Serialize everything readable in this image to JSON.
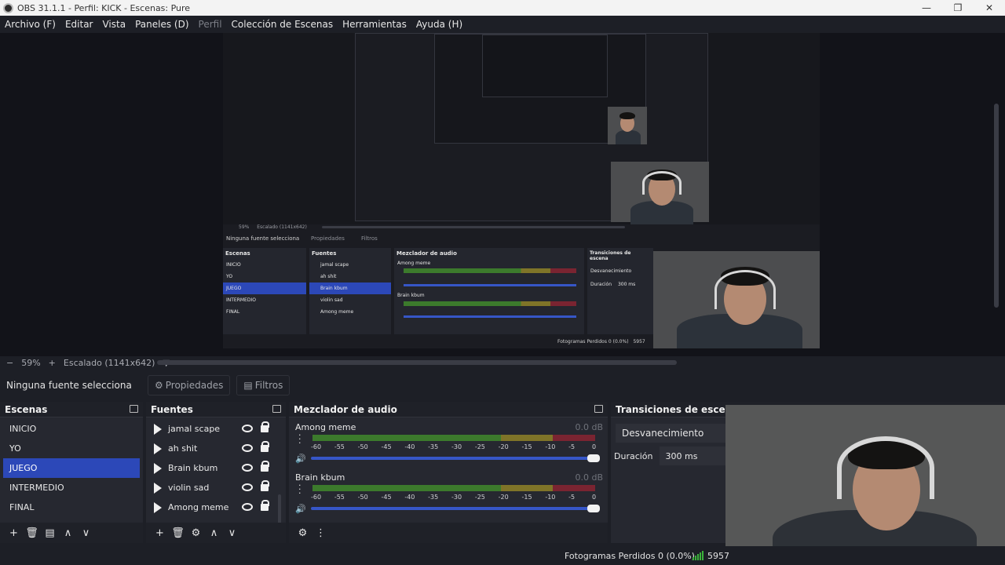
{
  "window": {
    "title": "OBS 31.1.1 - Perfil: KICK - Escenas: Pure",
    "minimize": "—",
    "restore": "❐",
    "close": "✕"
  },
  "menu": {
    "items": [
      "Archivo (F)",
      "Editar",
      "Vista",
      "Paneles (D)",
      "Perfil",
      "Colección de Escenas",
      "Herramientas",
      "Ayuda (H)"
    ]
  },
  "preview": {
    "zoom_minus": "−",
    "zoom_level": "59%",
    "zoom_plus": "+",
    "scale_label": "Escalado (1141x642)",
    "nested": {
      "no_source": "Ninguna fuente selecciona",
      "properties": "Propiedades",
      "filters": "Filtros",
      "scenes_title": "Escenas",
      "sources_title": "Fuentes",
      "mixer_title": "Mezclador de audio",
      "transitions_title": "Transiciones de escena",
      "scenes": [
        "INICIO",
        "YO",
        "JUEGO",
        "INTERMEDIO",
        "FINAL"
      ],
      "sources": [
        "jamal scape",
        "ah shit",
        "Brain kbum",
        "violin sad",
        "Among meme"
      ],
      "ch1": "Among meme",
      "ch2": "Brain kbum",
      "db": "0.0 dB",
      "fade": "Desvanecimiento",
      "duration_label": "Duración",
      "duration_value": "300 ms",
      "status": "Fotogramas Perdidos 0 (0.0%)",
      "bitrate": "5957",
      "zoom_level": "59%",
      "scale_label": "Escalado (1141x642)"
    }
  },
  "properties_bar": {
    "no_source": "Ninguna fuente selecciona",
    "properties_label": "Propiedades",
    "filters_label": "Filtros"
  },
  "scenes": {
    "title": "Escenas",
    "items": [
      "INICIO",
      "YO",
      "JUEGO",
      "INTERMEDIO",
      "FINAL"
    ],
    "active": "JUEGO"
  },
  "sources": {
    "title": "Fuentes",
    "items": [
      "jamal scape",
      "ah shit",
      "Brain kbum",
      "violin sad",
      "Among meme"
    ]
  },
  "mixer": {
    "title": "Mezclador de audio",
    "channels": [
      {
        "name": "Among meme",
        "db": "0.0 dB",
        "volume": 1.0
      },
      {
        "name": "Brain kbum",
        "db": "0.0 dB",
        "volume": 1.0
      }
    ],
    "ticks": [
      "-60",
      "-55",
      "-50",
      "-45",
      "-40",
      "-35",
      "-30",
      "-25",
      "-20",
      "-15",
      "-10",
      "-5",
      "0"
    ]
  },
  "transitions": {
    "title": "Transiciones de escena",
    "type": "Desvanecimiento",
    "duration_label": "Duración",
    "duration_value": "300 ms"
  },
  "status": {
    "dropped_frames": "Fotogramas Perdidos 0 (0.0%)",
    "bitrate": "5957"
  },
  "colors": {
    "accent": "#2c48b8",
    "meter_green": "#3c7a2c",
    "meter_yellow": "#7f7428",
    "meter_red": "#7a2431",
    "signal": "#3bb33b"
  },
  "icons": {
    "toolbar_scenes": [
      "plus-icon",
      "trash-icon",
      "filter-icon",
      "arrow-up-icon",
      "arrow-down-icon"
    ],
    "toolbar_sources": [
      "plus-icon",
      "trash-icon",
      "gear-icon",
      "arrow-up-icon",
      "arrow-down-icon"
    ],
    "toolbar_mixer": [
      "advanced-audio-icon",
      "kebab-menu-icon"
    ]
  }
}
